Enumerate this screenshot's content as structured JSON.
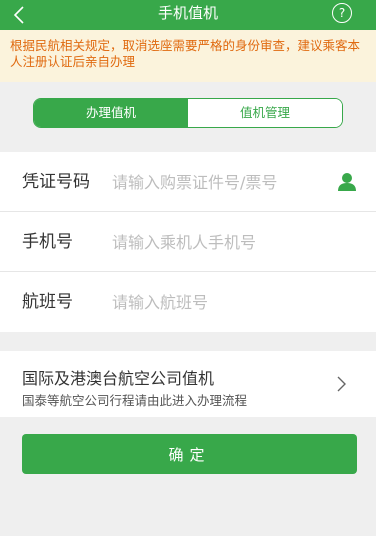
{
  "header": {
    "title": "手机值机",
    "back_icon": "chevron-left-icon",
    "help_icon": "help-circle-icon",
    "help_glyph": "?"
  },
  "notice": {
    "text": "根据民航相关规定，取消选座需要严格的身份审查，建议乘客本人注册认证后亲自办理"
  },
  "tabs": {
    "active_label": "办理值机",
    "inactive_label": "值机管理"
  },
  "form": {
    "credential": {
      "label": "凭证号码",
      "placeholder": "请输入购票证件号/票号",
      "icon": "person-icon"
    },
    "phone": {
      "label": "手机号",
      "placeholder": "请输入乘机人手机号"
    },
    "flight": {
      "label": "航班号",
      "placeholder": "请输入航班号"
    }
  },
  "international": {
    "title": "国际及港澳台航空公司值机",
    "subtitle": "国泰等航空公司行程请由此进入办理流程",
    "icon": "chevron-right-icon"
  },
  "confirm_label": "确定",
  "colors": {
    "primary": "#38a84a",
    "notice_bg": "#fbf3dc",
    "notice_text": "#e06a10",
    "background": "#efefef"
  }
}
